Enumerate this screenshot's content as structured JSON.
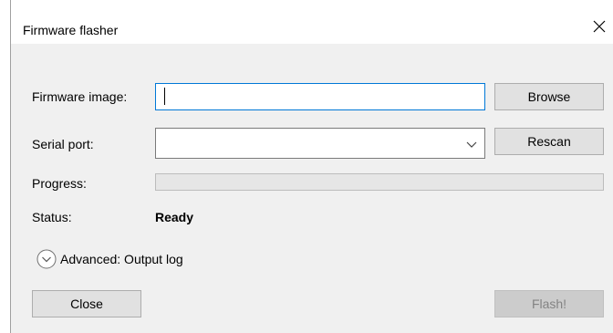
{
  "window": {
    "title": "Firmware flasher",
    "close_glyph": "✕"
  },
  "form": {
    "firmware_label": "Firmware image:",
    "firmware_value": "",
    "browse_label": "Browse",
    "port_label": "Serial port:",
    "port_value": "",
    "rescan_label": "Rescan",
    "progress_label": "Progress:",
    "progress_fraction": 0,
    "status_label": "Status:",
    "status_value": "Ready",
    "advanced_label": "Advanced: Output log"
  },
  "footer": {
    "close_label": "Close",
    "flash_label": "Flash!"
  },
  "colors": {
    "focus_border": "#0078d7",
    "disabled_text": "#838383"
  },
  "icons": {
    "close": "close-icon",
    "dropdown": "chevron-down-icon",
    "expand": "expand-circle-icon"
  }
}
